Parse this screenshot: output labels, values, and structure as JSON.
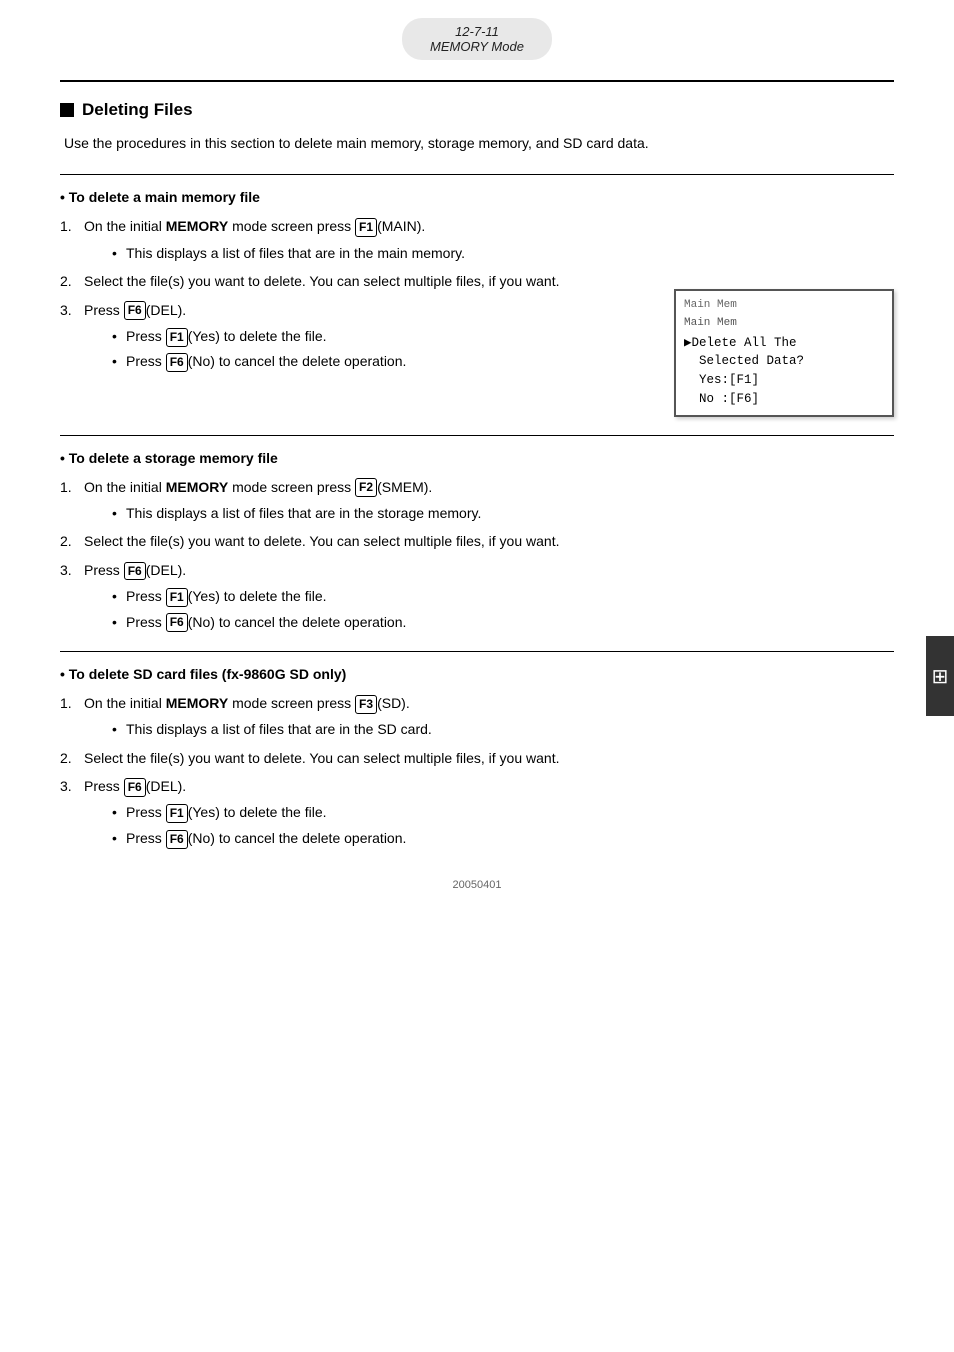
{
  "header": {
    "page_ref": "12-7-11",
    "subtitle": "MEMORY Mode"
  },
  "section": {
    "title": "Deleting Files",
    "intro": "Use the procedures in this section to delete main memory, storage memory, and SD card data."
  },
  "subsections": [
    {
      "id": "main-memory",
      "title": "To delete a main memory file",
      "steps": [
        {
          "num": "1.",
          "text_before": "On the initial ",
          "bold": "MEMORY",
          "text_after": " mode screen press ",
          "key": "F1",
          "key_label": "(MAIN).",
          "sub_bullets": [
            "This displays a list of files that are in the main memory."
          ]
        },
        {
          "num": "2.",
          "text_plain": "Select the file(s) you want to delete. You can select multiple files, if you want."
        },
        {
          "num": "3.",
          "text_before": "Press ",
          "key": "F6",
          "key_label": "(DEL).",
          "sub_bullets": [
            "Press [F1](Yes) to delete the file.",
            "Press [F6](No) to cancel the delete operation."
          ]
        }
      ],
      "screen": {
        "title": "Main Mem",
        "lines": [
          "▶Delete All The",
          "  Selected Data?",
          "  Yes:[F1]",
          "  No :[F6]"
        ]
      }
    },
    {
      "id": "storage-memory",
      "title": "To delete a storage memory file",
      "steps": [
        {
          "num": "1.",
          "text_before": "On the initial ",
          "bold": "MEMORY",
          "text_after": " mode screen press ",
          "key": "F2",
          "key_label": "(SMEM).",
          "sub_bullets": [
            "This displays a list of files that are in the storage memory."
          ]
        },
        {
          "num": "2.",
          "text_plain": "Select the file(s) you want to delete. You can select multiple files, if you want."
        },
        {
          "num": "3.",
          "text_before": "Press ",
          "key": "F6",
          "key_label": "(DEL).",
          "sub_bullets": [
            "Press [F1](Yes) to delete the file.",
            "Press [F6](No) to cancel the delete operation."
          ]
        }
      ]
    },
    {
      "id": "sd-card",
      "title": "To delete SD card files (fx-9860G SD only)",
      "steps": [
        {
          "num": "1.",
          "text_before": "On the initial ",
          "bold": "MEMORY",
          "text_after": " mode screen press ",
          "key": "F3",
          "key_label": "(SD).",
          "sub_bullets": [
            "This displays a list of files that are in the SD card."
          ]
        },
        {
          "num": "2.",
          "text_plain": "Select the file(s) you want to delete. You can select multiple files, if you want."
        },
        {
          "num": "3.",
          "text_before": "Press ",
          "key": "F6",
          "key_label": "(DEL).",
          "sub_bullets": [
            "Press [F1](Yes) to delete the file.",
            "Press [F6](No) to cancel the delete operation."
          ]
        }
      ]
    }
  ],
  "footer": {
    "code": "20050401"
  }
}
